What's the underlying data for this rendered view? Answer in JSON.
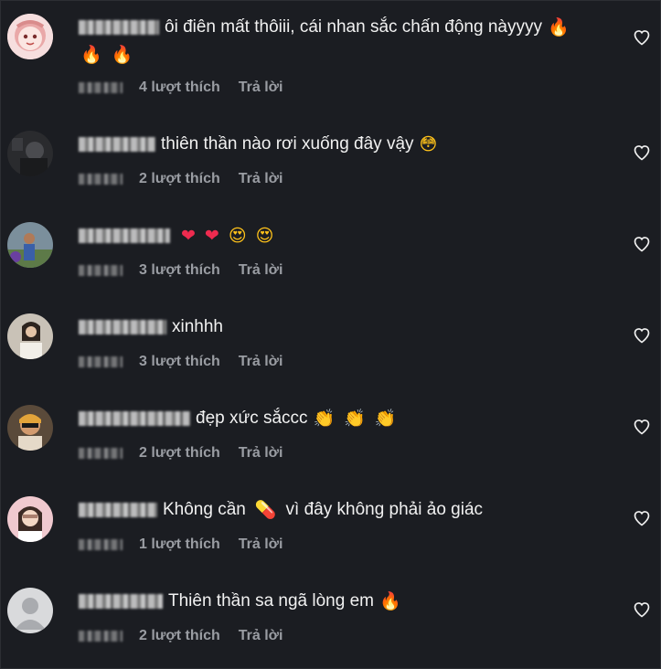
{
  "comments": [
    {
      "text": "ôi điên mất thôiii, cái nhan sắc chấn động nàyyyy",
      "emojis_inline": [
        "fire"
      ],
      "emojis_line2": [
        "fire",
        "fire"
      ],
      "likes_text": "4 lượt thích",
      "reply_label": "Trả lời",
      "avatar": "cartoon-pink-character"
    },
    {
      "text": "thiên thần nào rơi xuống đây vậy",
      "emojis_inline": [
        "flushed"
      ],
      "likes_text": "2 lượt thích",
      "reply_label": "Trả lời",
      "avatar": "dark-photo"
    },
    {
      "text": "",
      "emojis_inline": [
        "heart",
        "heart",
        "starry",
        "starry"
      ],
      "likes_text": "3 lượt thích",
      "reply_label": "Trả lời",
      "avatar": "person-outdoor"
    },
    {
      "text": "xinhhh",
      "emojis_inline": [],
      "likes_text": "3 lượt thích",
      "reply_label": "Trả lời",
      "avatar": "girl-photo"
    },
    {
      "text": "đẹp xức sắccc",
      "emojis_inline": [
        "clap",
        "clap",
        "clap"
      ],
      "likes_text": "2 lượt thích",
      "reply_label": "Trả lời",
      "avatar": "man-sunglasses"
    },
    {
      "text": "Không cần",
      "text_after": "vì đây không phải ảo giác",
      "emojis_inline": [
        "pill"
      ],
      "likes_text": "1 lượt thích",
      "reply_label": "Trả lời",
      "avatar": "girl-pink-bg"
    },
    {
      "text": "Thiên thần sa ngã lòng em",
      "emojis_inline": [
        "fire"
      ],
      "likes_text": "2 lượt thích",
      "reply_label": "Trả lời",
      "avatar": "default-silhouette"
    }
  ],
  "icons": {
    "like": "heart-outline-icon"
  },
  "colors": {
    "background": "#1b1d22",
    "text": "#f1f1f1",
    "meta": "#9a9da3"
  }
}
